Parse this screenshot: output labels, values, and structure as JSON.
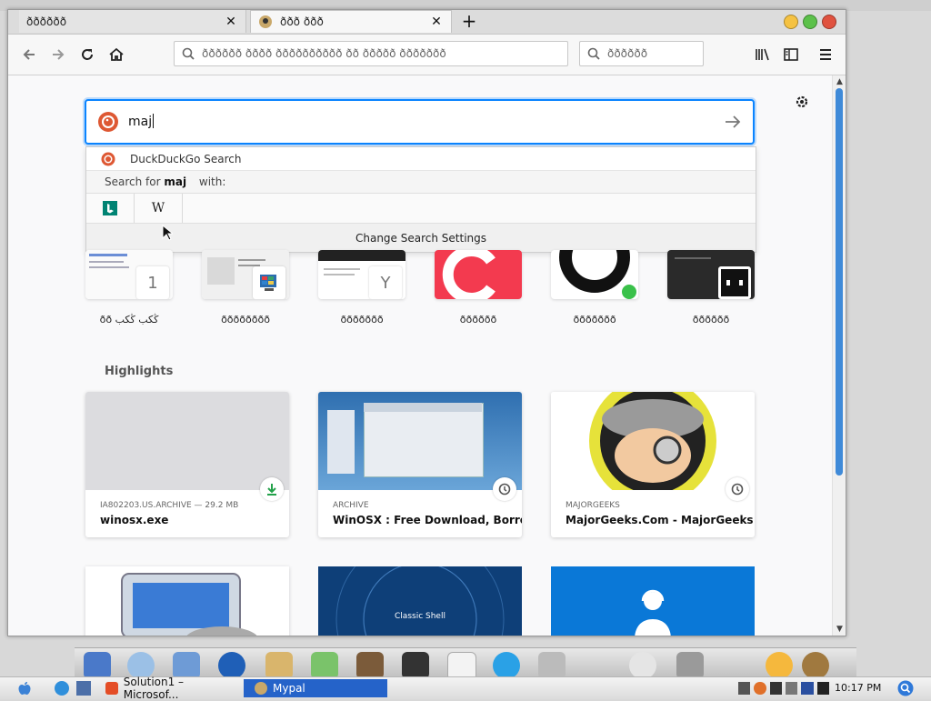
{
  "browser": {
    "tabs": [
      {
        "title": "ðððððð",
        "close": "✕"
      },
      {
        "title": "ððð ððð",
        "close": "✕"
      }
    ],
    "newtab_label": "+",
    "url_placeholder": "ðððððð ðððð ðððððððððð ðð ððððð ððððððð",
    "search_placeholder": "ðððððð"
  },
  "newtab": {
    "search_query": "maj",
    "dropdown": {
      "engine_name": "DuckDuckGo Search",
      "search_for_prefix": "Search for ",
      "search_for_term": "maj",
      "search_for_suffix": " with:",
      "change_settings": "Change Search Settings",
      "engines": [
        "bing",
        "W"
      ]
    },
    "top_sites": [
      {
        "label": "ðð  ڭکب  ڭکب",
        "badge": "1"
      },
      {
        "label": "ðððððððð",
        "badge": ""
      },
      {
        "label": "ððððððð",
        "badge": "Y"
      },
      {
        "label": "ðððððð",
        "badge": ""
      },
      {
        "label": "ððððððð",
        "badge": ""
      },
      {
        "label": "ðððððð",
        "badge": ""
      }
    ],
    "highlights_title": "Highlights",
    "highlights": [
      {
        "meta": "IA802203.US.ARCHIVE — 29.2 MB",
        "title": "winosx.exe"
      },
      {
        "meta": "ARCHIVE",
        "title": "WinOSX : Free Download, Borro..."
      },
      {
        "meta": "MAJORGEEKS",
        "title": "MajorGeeks.Com - MajorGeeks"
      }
    ],
    "second_row": [
      {
        "caption": ""
      },
      {
        "caption": "Classic Shell"
      },
      {
        "caption": ""
      }
    ]
  },
  "taskbar": {
    "items": [
      "Solution1 – Microsof...",
      "Mypal"
    ],
    "clock": "10:17 PM"
  },
  "colors": {
    "accent": "#0a84ff",
    "scroll": "#3f8ad8",
    "taskbar_active": "#2563c9"
  }
}
